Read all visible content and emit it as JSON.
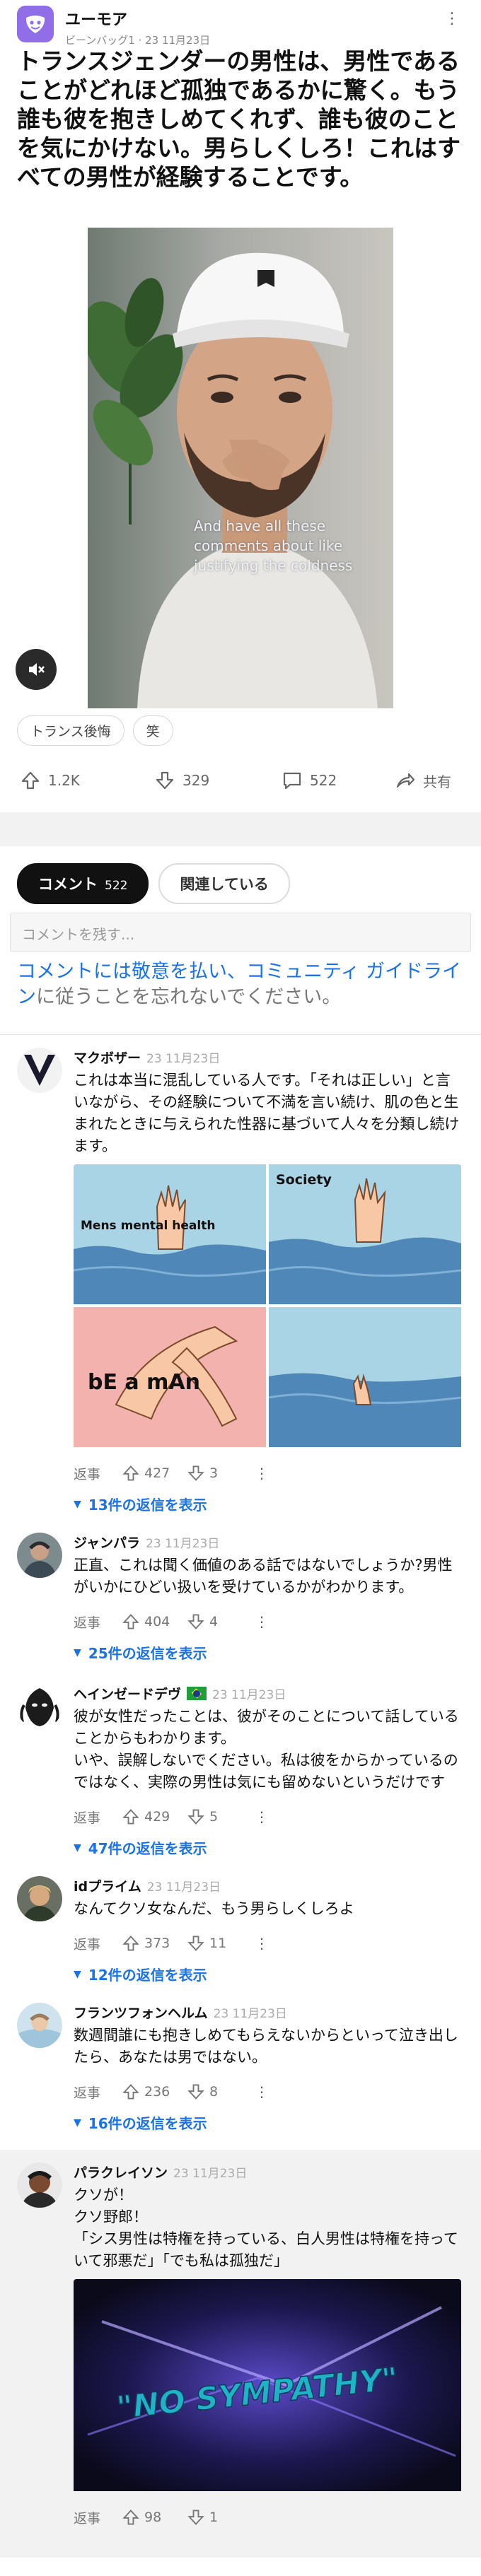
{
  "post": {
    "app_name": "ユーモア",
    "meta": "ビーンバッグ1 · 23 11月23日",
    "title": "トランスジェンダーの男性は、男性であることがどれほど孤独であるかに驚く。もう誰も彼を抱きしめてくれず、誰も彼のことを気にかけない。男らしくしろ！これはすべての男性が経験することです。",
    "video_caption": "And have all these comments about like justifying the coldness",
    "tags": [
      "トランス後悔",
      "笑"
    ],
    "upvotes": "1.2K",
    "downvotes": "329",
    "comments": "522",
    "share": "共有"
  },
  "tabs": [
    {
      "label": "コメント",
      "count": "522"
    },
    {
      "label": "関連している"
    }
  ],
  "comment_input": {
    "placeholder": "コメントを残す..."
  },
  "guideline": {
    "blue": "コメントには敬意を払い、コミュニティ ガイドライン",
    "gray": "に従うことを忘れないでください。"
  },
  "meme": {
    "p1": "Mens mental health",
    "p2": "Society",
    "p3": "bE a mAn"
  },
  "no_sympathy": "\"NO SYMPATHY\"",
  "comments": [
    {
      "name": "マクボザー",
      "date": "23 11月23日",
      "text": "これは本当に混乱している人です。「それは正しい」と言いながら、その経験について不満を言い続け、肌の色と生まれたときに与えられた性器に基づいて人々を分類し続けます。",
      "reply": "返事",
      "up": "427",
      "down": "3",
      "replies": "13件の返信を表示"
    },
    {
      "name": "ジャンパラ",
      "date": "23 11月23日",
      "text": "正直、これは聞く価値のある話ではないでしょうか?男性がいかにひどい扱いを受けているかがわかります。",
      "reply": "返事",
      "up": "404",
      "down": "4",
      "replies": "25件の返信を表示"
    },
    {
      "name": "ヘインゼードデヴ",
      "date": "23 11月23日",
      "text": "彼が女性だったことは、彼がそのことについて話していることからもわかります。\nいや、誤解しないでください。私は彼をからかっているのではなく、実際の男性は気にも留めないというだけです",
      "reply": "返事",
      "up": "429",
      "down": "5",
      "replies": "47件の返信を表示"
    },
    {
      "name": "idプライム",
      "date": "23 11月23日",
      "text": "なんてクソ女なんだ、もう男らしくしろよ",
      "reply": "返事",
      "up": "373",
      "down": "11",
      "replies": "12件の返信を表示"
    },
    {
      "name": "フランツフォンヘルム",
      "date": "23 11月23日",
      "text": "数週間誰にも抱きしめてもらえないからといって泣き出したら、あなたは男ではない。",
      "reply": "返事",
      "up": "236",
      "down": "8",
      "replies": "16件の返信を表示"
    },
    {
      "name": "パラクレイソン",
      "date": "23 11月23日",
      "text": "クソが！\nクソ野郎！\n「シス男性は特権を持っている、白人男性は特権を持っていて邪悪だ」「でも私は孤独だ」",
      "reply": "返事",
      "up": "98",
      "down": "1"
    }
  ]
}
